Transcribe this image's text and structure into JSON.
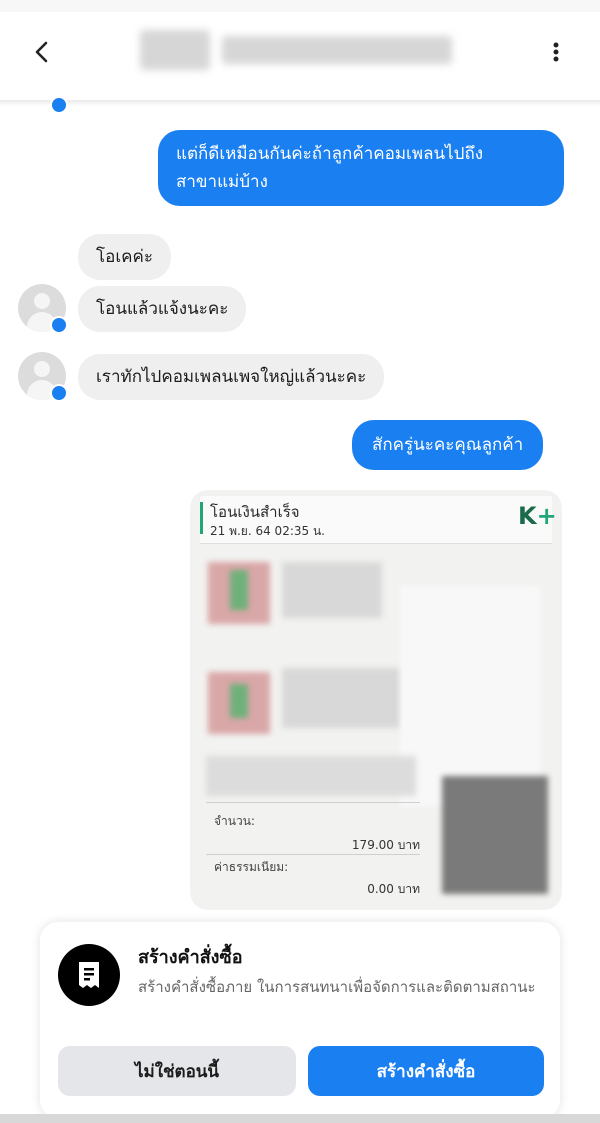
{
  "header": {
    "back_icon": "chevron-left-icon",
    "more_icon": "vertical-dots-icon"
  },
  "messages": [
    {
      "side": "out",
      "text_lines": [
        "แต่ก็ดีเหมือนกันค่ะถ้าลูกค้าคอมเพลนไปถึง",
        "สาขาแม่บ้าง"
      ]
    },
    {
      "side": "in",
      "text": "โอเคค่ะ"
    },
    {
      "side": "in",
      "text": "โอนแล้วแจ้งนะคะ"
    },
    {
      "side": "in",
      "text": "เราทักไปคอมเพลนเพจใหญ่แล้วนะคะ"
    },
    {
      "side": "out",
      "text": "สักครู่นะคะคุณลูกค้า"
    }
  ],
  "receipt": {
    "title": "โอนเงินสำเร็จ",
    "datetime": "21 พ.ย. 64  02:35 น.",
    "logo_k": "K",
    "logo_plus": "+",
    "amount_label": "จำนวน:",
    "amount_value": "179.00 บาท",
    "fee_label": "ค่าธรรมเนียม:",
    "fee_value": "0.00 บาท"
  },
  "order_sheet": {
    "icon": "receipt-icon",
    "title": "สร้างคำสั่งซื้อ",
    "description": "สร้างคำสั่งซื้อภาย ในการสนทนาเพื่อจัดการและติดตามสถานะ",
    "secondary_button": "ไม่ใช่ตอนนี้",
    "primary_button": "สร้างคำสั่งซื้อ"
  },
  "colors": {
    "accent": "#1a7ff0",
    "incoming_bubble": "#efefef",
    "kplus_green": "#21a67a"
  }
}
